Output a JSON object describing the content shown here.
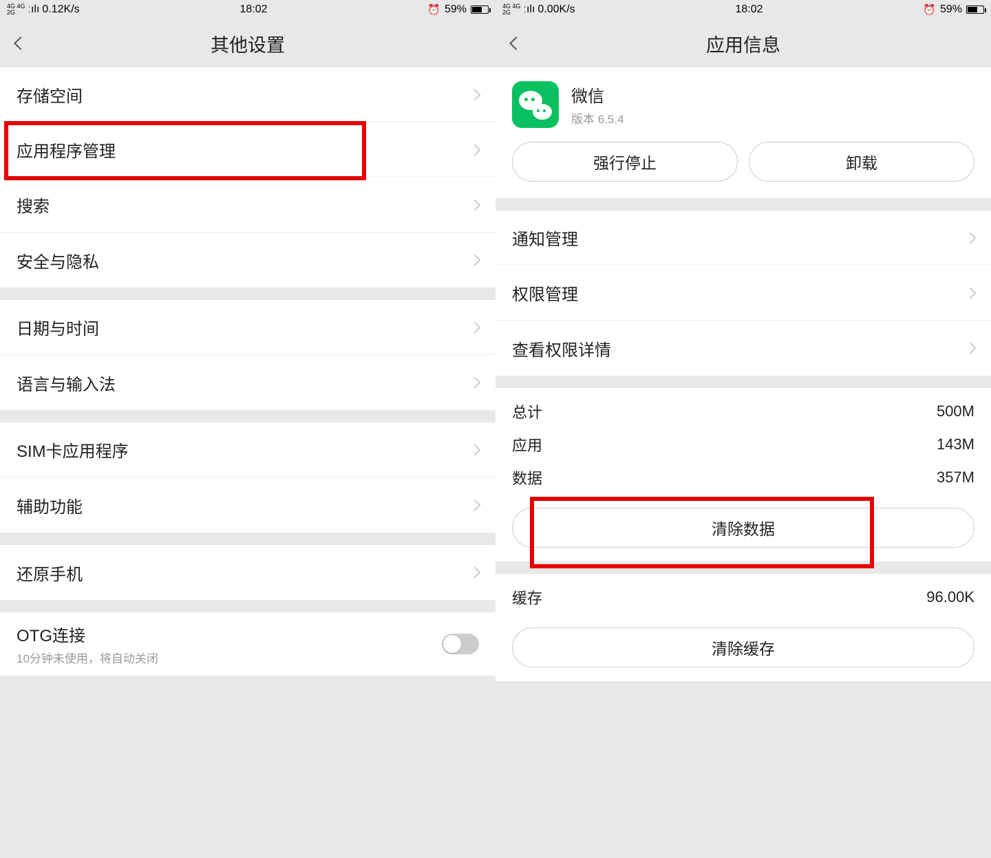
{
  "left": {
    "status": {
      "net": "0.12K/s",
      "time": "18:02",
      "battery": "59%"
    },
    "title": "其他设置",
    "items": {
      "storage": "存储空间",
      "apps": "应用程序管理",
      "search": "搜索",
      "security": "安全与隐私",
      "datetime": "日期与时间",
      "language": "语言与输入法",
      "sim": "SIM卡应用程序",
      "accessibility": "辅助功能",
      "reset": "还原手机",
      "otg": "OTG连接",
      "otg_sub": "10分钟未使用，将自动关闭"
    }
  },
  "right": {
    "status": {
      "net": "0.00K/s",
      "time": "18:02",
      "battery": "59%"
    },
    "title": "应用信息",
    "app": {
      "name": "微信",
      "version": "版本 6.5.4"
    },
    "buttons": {
      "force_stop": "强行停止",
      "uninstall": "卸载",
      "clear_data": "清除数据",
      "clear_cache": "清除缓存"
    },
    "items": {
      "notifications": "通知管理",
      "permissions": "权限管理",
      "perm_detail": "查看权限详情"
    },
    "storage": {
      "total_label": "总计",
      "total_val": "500M",
      "app_label": "应用",
      "app_val": "143M",
      "data_label": "数据",
      "data_val": "357M",
      "cache_label": "缓存",
      "cache_val": "96.00K"
    }
  }
}
